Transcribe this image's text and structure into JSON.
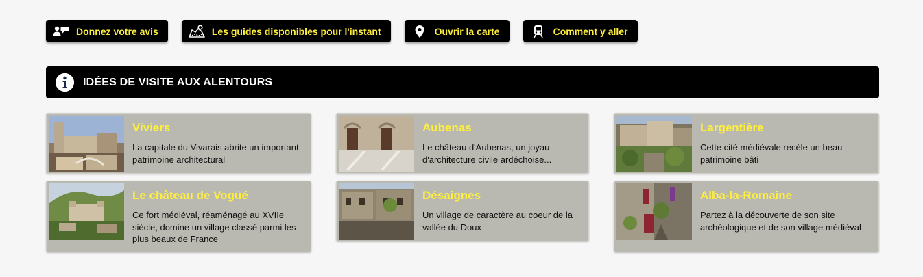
{
  "toolbar": {
    "buttons": [
      {
        "label": "Donnez votre avis",
        "icon": "users-comment-icon"
      },
      {
        "label": "Les guides disponibles pour l'instant",
        "icon": "map-route-icon"
      },
      {
        "label": "Ouvrir la carte",
        "icon": "map-pin-icon"
      },
      {
        "label": "Comment y aller",
        "icon": "train-icon"
      }
    ]
  },
  "section": {
    "title": "IDÉES DE VISITE AUX ALENTOURS",
    "icon": "info-icon"
  },
  "places": [
    {
      "name": "Viviers",
      "description": "La capitale du Vivarais abrite un important patrimoine architectural"
    },
    {
      "name": "Aubenas",
      "description": "Le château d'Aubenas, un joyau d'architecture civile ardéchoise..."
    },
    {
      "name": "Largentière",
      "description": "Cette cité médiévale recèle un beau patrimoine bâti"
    },
    {
      "name": "Le château de Vogüé",
      "description": "Ce fort médiéval, réaménagé au XVIIe siècle, domine un village classé parmi les plus beaux de France"
    },
    {
      "name": "Désaignes",
      "description": "Un village de caractère au coeur de la vallée du Doux"
    },
    {
      "name": "Alba-la-Romaine",
      "description": "Partez à la découverte de son site archéologique et de son village médiéval"
    }
  ],
  "colors": {
    "accent": "#ffef3d",
    "card_bg": "#b9b8b1",
    "header_bg": "#000000"
  }
}
